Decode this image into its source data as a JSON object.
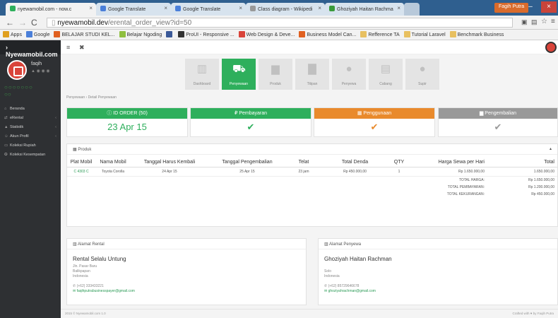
{
  "browser": {
    "tabs": [
      {
        "label": "nyewamobil.com - now.c",
        "icon_color": "#2eaf5c",
        "active": true
      },
      {
        "label": "Google Translate",
        "icon_color": "#4a7fd9",
        "active": false
      },
      {
        "label": "Google Translate",
        "icon_color": "#4a7fd9",
        "active": false
      },
      {
        "label": "Class diagram - Wikipedi",
        "icon_color": "#999999",
        "active": false
      },
      {
        "label": "Ghoziyah Haitan Rachma",
        "icon_color": "#3a9a3a",
        "active": false
      }
    ],
    "user": "Fagih Putra",
    "url_host": "nyewamobil.dev",
    "url_path": "/erental_order_view?id=50",
    "bookmarks": [
      {
        "label": "Apps",
        "color": "#e0a020"
      },
      {
        "label": "Google",
        "color": "#4a7fd9"
      },
      {
        "label": "BELAJAR STUDI KEL...",
        "color": "#e06020"
      },
      {
        "label": "Belajar Ngoding",
        "color": "#8fbf3f"
      },
      {
        "label": "",
        "color": "#3b5998"
      },
      {
        "label": "ProUI - Responsive ...",
        "color": "#333333"
      },
      {
        "label": "Web Design & Deve...",
        "color": "#d9443a"
      },
      {
        "label": "Business Model Can...",
        "color": "#e06020"
      },
      {
        "label": "Refference TA",
        "color": "#e8c060"
      },
      {
        "label": "Tutorial Laravel",
        "color": "#e8c060"
      },
      {
        "label": "Benchmark Business",
        "color": "#e8c060"
      }
    ]
  },
  "sidebar": {
    "brand": "Nyewamobil.com",
    "user_name": "faqih",
    "menu": [
      {
        "label": "Beranda",
        "icon": "⌂",
        "arrow": false
      },
      {
        "label": "eRental",
        "icon": "⇄",
        "arrow": true
      },
      {
        "label": "Statistik",
        "icon": "▲",
        "arrow": true
      },
      {
        "label": "Akun Profil",
        "icon": "☺",
        "arrow": true
      },
      {
        "label": "Koleksi Rupiah",
        "icon": "▭",
        "arrow": false
      },
      {
        "label": "Koleksi Kesempatan",
        "icon": "✪",
        "arrow": false
      }
    ]
  },
  "steps": [
    {
      "label": "Dashboard",
      "icon": "bar-chart-icon",
      "glyph": "▥",
      "active": false
    },
    {
      "label": "Penyewaan",
      "icon": "cart-icon",
      "glyph": "🛒",
      "active": true
    },
    {
      "label": "Produk",
      "icon": "car-icon",
      "glyph": "▆",
      "active": false
    },
    {
      "label": "Titipan",
      "icon": "truck-icon",
      "glyph": "▇",
      "active": false
    },
    {
      "label": "Penyewa",
      "icon": "user-icon",
      "glyph": "●",
      "active": false
    },
    {
      "label": "Cabang",
      "icon": "building-icon",
      "glyph": "▤",
      "active": false
    },
    {
      "label": "Supir",
      "icon": "driver-icon",
      "glyph": "●",
      "active": false
    }
  ],
  "breadcrumb": "Penyewaan › Detail Penyewaan",
  "status_cards": [
    {
      "title": "ID ORDER (50)",
      "value": "23 Apr 15",
      "color": "#2eaf5c",
      "kind": "text"
    },
    {
      "title": "Pembayaran",
      "value": "✔",
      "color": "#2eaf5c",
      "kind": "check",
      "check_color": "#2eaf5c"
    },
    {
      "title": "Penggunaan",
      "value": "✔",
      "color": "#e98a2c",
      "kind": "check",
      "check_color": "#e98a2c"
    },
    {
      "title": "Pengembalian",
      "value": "✔",
      "color": "#999999",
      "kind": "check",
      "check_color": "#999999"
    }
  ],
  "product_section": {
    "title": "Produk",
    "columns": [
      "Plat Mobil",
      "Nama Mobil",
      "Tanggal Harus Kembali",
      "Tanggal Pengembalian",
      "Telat",
      "Total Denda",
      "QTY",
      "Harga Sewa per Hari",
      "Total"
    ],
    "rows": [
      [
        "C 4303 C",
        "Toyota Corolla",
        "24 Apr 15",
        "25 Apr 15",
        "23 jam",
        "Rp 450.000,00",
        "1",
        "Rp 1.650.000,00",
        "1.650.000,00"
      ]
    ],
    "totals": [
      {
        "label": "TOTAL HARGA:",
        "value": "Rp 1.650.000,00"
      },
      {
        "label": "TOTAL PEMBAYARAN:",
        "value": "Rp 1.200.000,00"
      },
      {
        "label": "TOTAL KEKURANGAN:",
        "value": "Rp 450.000,00"
      }
    ]
  },
  "rental_address": {
    "title": "Alamat Rental",
    "name": "Rental Selalu Untung",
    "line1": "Jln. Pasar Baru",
    "line2": "Balikpapan",
    "line3": "Indonesia",
    "phone": "(+62) 333433221",
    "email": "faqihputrabusinesspayer@gmail.com"
  },
  "renter_address": {
    "title": "Alamat Penyewa",
    "name": "Ghoziyah Haitan Rachman",
    "line1": "Solo",
    "line2": "Indonesia",
    "phone": "(+62) 85729646678",
    "email": "ghoziyahrachman@gmail.com"
  },
  "footer": {
    "left": "2015 © Nyewamobil.com 1.0",
    "right": "Crafted with ♥ by Faqih Putra"
  }
}
